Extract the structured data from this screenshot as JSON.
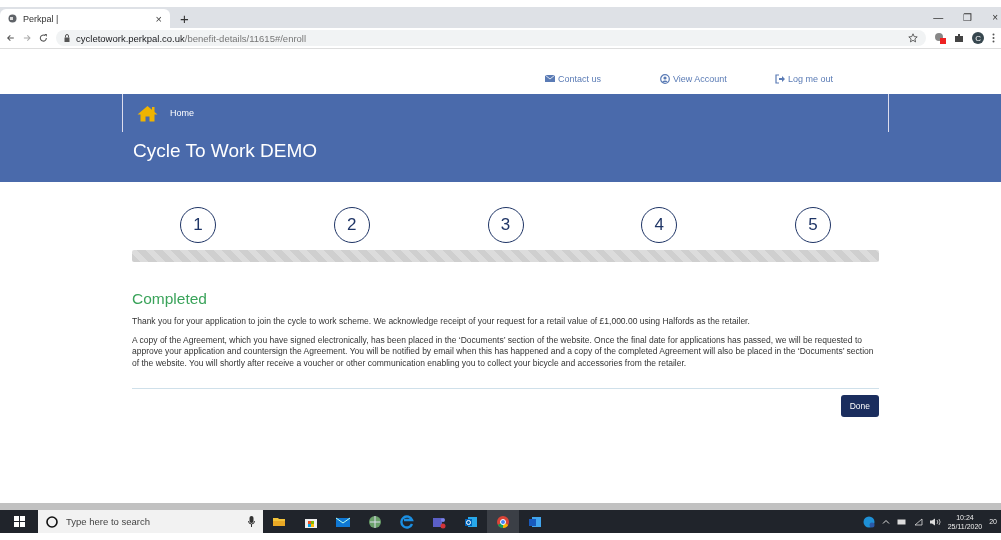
{
  "browser": {
    "tab_title": "Perkpal |",
    "tab_close": "×",
    "new_tab": "+",
    "url_host": "cycletowork.perkpal.co.uk",
    "url_path": "/benefit-details/11615#/enroll",
    "profile_initial": "C",
    "window_controls": [
      "—",
      "❐",
      "×"
    ]
  },
  "top_links": [
    {
      "kind": "mail",
      "label": "Contact us"
    },
    {
      "kind": "user",
      "label": "View Account"
    },
    {
      "kind": "logout",
      "label": "Log me out"
    }
  ],
  "breadcrumb": {
    "label": "Home"
  },
  "page_title": "Cycle To Work DEMO",
  "steps": [
    "1",
    "2",
    "3",
    "4",
    "5"
  ],
  "status_heading": "Completed",
  "paragraphs": [
    "Thank you for your application to join the cycle to work scheme. We acknowledge receipt of your request for a retail value of £1,000.00 using Halfords as the retailer.",
    "A copy of the Agreement, which you have signed electronically, has been placed in the ‘Documents’ section of the website. Once the final date for applications has passed, we will be requested to approve your application and countersign the Agreement. You will be notified by email when this has happened and a copy of the completed Agreement will also be placed in the ‘Documents’ section of the website. You will shortly after receive a voucher or other communication enabling you to collect your bicycle and accessories from the retailer."
  ],
  "done_button": "Done",
  "taskbar": {
    "search_placeholder": "Type here to search",
    "apps": [
      {
        "kind": "folder",
        "selected": false
      },
      {
        "kind": "store",
        "selected": false
      },
      {
        "kind": "mail",
        "selected": false
      },
      {
        "kind": "globe",
        "selected": false
      },
      {
        "kind": "edge",
        "selected": false
      },
      {
        "kind": "teams",
        "selected": false
      },
      {
        "kind": "outlook",
        "selected": false
      },
      {
        "kind": "chrome",
        "selected": true
      },
      {
        "kind": "word",
        "selected": false
      }
    ],
    "time": "10:24",
    "date": "25/11/2020",
    "notification_count": "20"
  }
}
